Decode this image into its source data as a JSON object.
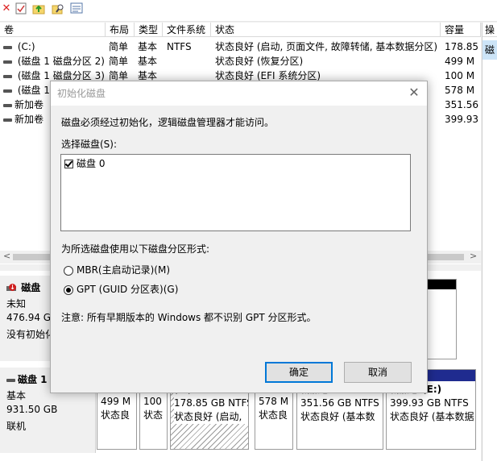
{
  "toolbar": {
    "icons": [
      "delete-icon",
      "checklist-icon",
      "up-folder-icon",
      "search-folder-icon",
      "properties-icon"
    ]
  },
  "volume_list": {
    "columns": [
      "卷",
      "布局",
      "类型",
      "文件系统",
      "状态",
      "容量"
    ],
    "rows": [
      {
        "volume": " (C:)",
        "layout": "简单",
        "type": "基本",
        "fs": "NTFS",
        "status": "状态良好 (启动, 页面文件, 故障转储, 基本数据分区)",
        "capacity": "178.85"
      },
      {
        "volume": " (磁盘 1 磁盘分区 2)",
        "layout": "简单",
        "type": "基本",
        "fs": "",
        "status": "状态良好 (恢复分区)",
        "capacity": "499 M"
      },
      {
        "volume": " (磁盘 1 磁盘分区 3)",
        "layout": "简单",
        "type": "基本",
        "fs": "",
        "status": "状态良好 (EFI 系统分区)",
        "capacity": "100 M"
      },
      {
        "volume": " (磁盘 1",
        "layout": "",
        "type": "",
        "fs": "",
        "status": "",
        "capacity": "578 M"
      },
      {
        "volume": "新加卷",
        "layout": "",
        "type": "",
        "fs": "",
        "status": "",
        "capacity": "351.56"
      },
      {
        "volume": "新加卷",
        "layout": "",
        "type": "",
        "fs": "",
        "status": "",
        "capacity": "399.93"
      }
    ]
  },
  "action_pane": {
    "header": "操",
    "item": "磁"
  },
  "disk0": {
    "name": "磁盘",
    "state": "未知",
    "size": "476.94 GB",
    "note": "没有初始化"
  },
  "disk1": {
    "name": "磁盘 1",
    "type": "基本",
    "size": "931.50 GB",
    "status": "联机",
    "partitions": [
      {
        "line1": "499 M",
        "line2": "状态良"
      },
      {
        "line1": "100",
        "line2": "状态"
      },
      {
        "line0": "(C:)",
        "line1": "178.85 GB NTFS",
        "line2": "状态良好 (启动,"
      },
      {
        "line1": "578 M",
        "line2": "状态良"
      },
      {
        "line0": "新加卷",
        "line1": "351.56 GB NTFS",
        "line2": "状态良好 (基本数"
      },
      {
        "line0": "新加卷 (E:)",
        "line1": "399.93 GB NTFS",
        "line2": "状态良好 (基本数据"
      }
    ]
  },
  "dialog": {
    "title": "初始化磁盘",
    "message": "磁盘必须经过初始化，逻辑磁盘管理器才能访问。",
    "select_label": "选择磁盘(S):",
    "disk_item": "磁盘 0",
    "partition_style_label": "为所选磁盘使用以下磁盘分区形式:",
    "mbr_label": "MBR(主启动记录)(M)",
    "gpt_label": "GPT (GUID 分区表)(G)",
    "selected_style": "GPT",
    "note": "注意: 所有早期版本的 Windows 都不识别 GPT 分区形式。",
    "ok_label": "确定",
    "cancel_label": "取消"
  }
}
